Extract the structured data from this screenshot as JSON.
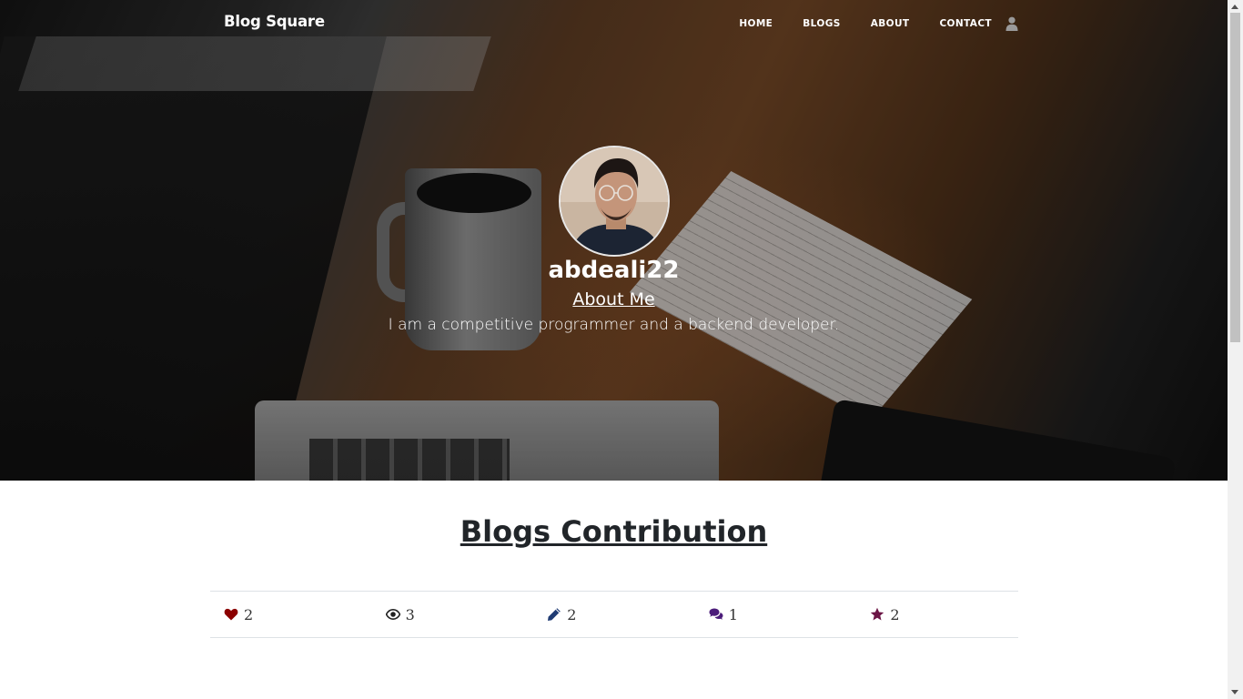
{
  "nav": {
    "brand": "Blog Square",
    "links": [
      "HOME",
      "BLOGS",
      "ABOUT",
      "CONTACT"
    ],
    "user_icon": "user-icon"
  },
  "profile": {
    "username": "abdeali22",
    "about_link": "About Me",
    "bio": "I am a competitive programmer and a backend developer."
  },
  "contribution": {
    "title": "Blogs Contribution",
    "stats": [
      {
        "icon": "heart-icon",
        "value": "2",
        "color": "#8b0000"
      },
      {
        "icon": "eye-icon",
        "value": "3",
        "color": "#222222"
      },
      {
        "icon": "pencil-icon",
        "value": "2",
        "color": "#1f3b73"
      },
      {
        "icon": "comments-icon",
        "value": "1",
        "color": "#4b1c7a"
      },
      {
        "icon": "star-icon",
        "value": "2",
        "color": "#6b1545"
      }
    ]
  }
}
